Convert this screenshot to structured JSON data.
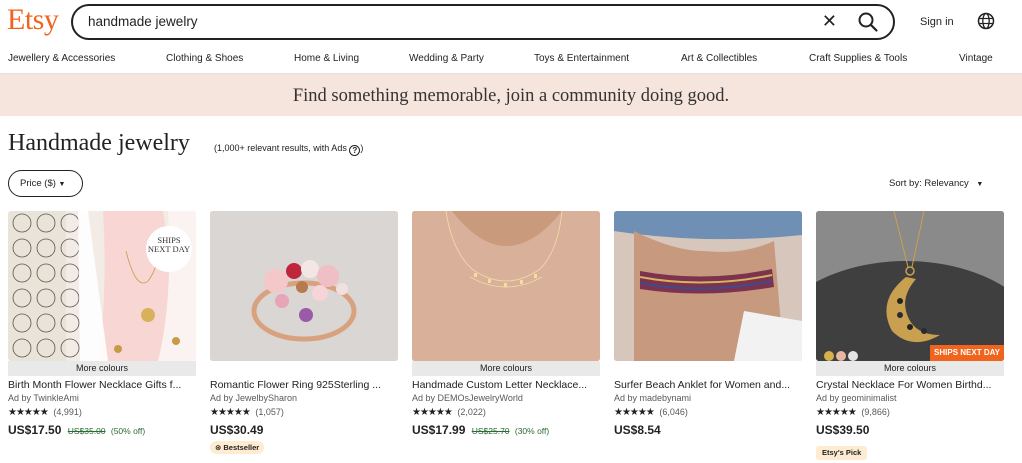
{
  "header": {
    "logo": "Etsy",
    "search_value": "handmade jewelry",
    "sign_in": "Sign in"
  },
  "categories": [
    "Jewellery & Accessories",
    "Clothing & Shoes",
    "Home & Living",
    "Wedding & Party",
    "Toys & Entertainment",
    "Art & Collectibles",
    "Craft Supplies & Tools",
    "Vintage"
  ],
  "banner": "Find something memorable, join a community doing good.",
  "results": {
    "heading": "Handmade jewelry",
    "count": "(1,000+ relevant results, with Ads",
    "filter_label": "Price ($)",
    "sort_label": "Sort by: Relevancy"
  },
  "listings": [
    {
      "title": "Birth Month Flower Necklace Gifts f...",
      "ad_by": "Ad by TwinkleAmi",
      "stars": "★★★★★",
      "reviews": "(4,991)",
      "price": "US$17.50",
      "original_price": "US$35.00",
      "discount": "(50% off)",
      "more_colours": "More colours",
      "image_badge": "SHIPS NEXT DAY"
    },
    {
      "title": "Romantic Flower Ring 925Sterling ...",
      "ad_by": "Ad by JewelbySharon",
      "stars": "★★★★★",
      "reviews": "(1,057)",
      "price": "US$30.49",
      "badge": "Bestseller"
    },
    {
      "title": "Handmade Custom Letter Necklace...",
      "ad_by": "Ad by DEMOsJewelryWorld",
      "stars": "★★★★★",
      "reviews": "(2,022)",
      "price": "US$17.99",
      "original_price": "US$25.70",
      "discount": "(30% off)",
      "more_colours": "More colours"
    },
    {
      "title": "Surfer Beach Anklet for Women and...",
      "ad_by": "Ad by madebynami",
      "stars": "★★★★★",
      "reviews": "(6,046)",
      "price": "US$8.54"
    },
    {
      "title": "Crystal Necklace For Women Birthd...",
      "ad_by": "Ad by geominimalist",
      "stars": "★★★★★",
      "reviews": "(9,866)",
      "price": "US$39.50",
      "more_colours": "More colours",
      "ships_badge": "SHIPS NEXT DAY",
      "pick_badge": "Etsy's Pick"
    }
  ],
  "colors": {
    "brand": "#f1641e",
    "banner_bg": "#f6e5dd",
    "sale_green": "#2b6b36",
    "badge_bg": "#fdebd2"
  }
}
